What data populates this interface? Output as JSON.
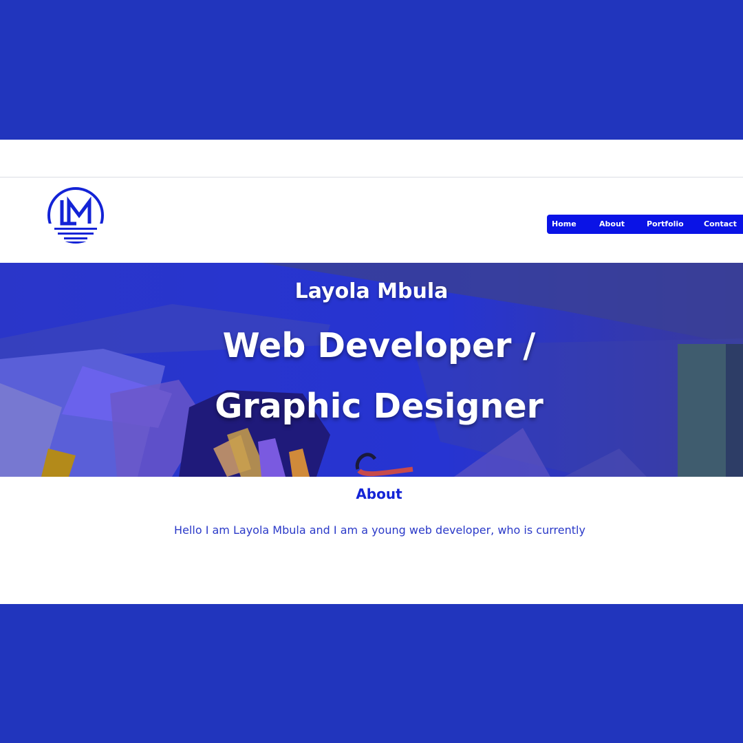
{
  "colors": {
    "frame": "#2135bd",
    "nav": "#0a13e6",
    "accent": "#1323d6",
    "text": "#2a39c8"
  },
  "logo": {
    "icon": "lm-monogram-icon"
  },
  "nav": {
    "items": [
      "Home",
      "About",
      "Portfolio",
      "Contact"
    ]
  },
  "hero": {
    "name": "Layola Mbula",
    "role_line1": "Web Developer /",
    "role_line2": "Graphic Designer"
  },
  "about": {
    "title": "About",
    "text": "Hello I am Layola Mbula and I am a young web developer, who is currently"
  }
}
